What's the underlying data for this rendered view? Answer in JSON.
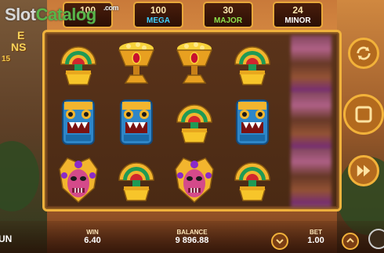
{
  "watermark": {
    "part1": "Slot",
    "part2": "Catalog",
    "part3": ".com"
  },
  "game_title": {
    "line1": "E",
    "line2": "NS",
    "line3": "15"
  },
  "jackpots": [
    {
      "name": "mini-jackpot",
      "value": "100",
      "label": ""
    },
    {
      "name": "mega-jackpot",
      "value": "100",
      "label": "MEGA",
      "color": "#3fd0ff"
    },
    {
      "name": "major-jackpot",
      "value": "30",
      "label": "MAJOR",
      "color": "#8ee04a"
    },
    {
      "name": "minor-jackpot",
      "value": "24",
      "label": "MINOR",
      "color": "#ffffff"
    }
  ],
  "grid": {
    "columns": 4,
    "rows": [
      [
        "green-fan",
        "treasure-chalice",
        "treasure-chalice",
        "green-fan"
      ],
      [
        "blue-mask",
        "blue-mask",
        "green-fan",
        "blue-mask"
      ],
      [
        "pink-mask",
        "green-fan",
        "pink-mask",
        "green-fan"
      ]
    ],
    "spinning_reel": "blurred-reel-5"
  },
  "controls": {
    "autoplay_icon": "refresh-icon",
    "spin_icon": "stop-square-icon",
    "turbo_icon": "fast-forward-icon"
  },
  "bottom": {
    "left_text": "UN",
    "win_label": "WIN",
    "win_value": "6.40",
    "balance_label": "BALANCE",
    "balance_value": "9 896.88",
    "bet_label": "BET",
    "bet_value": "1.00",
    "bet_down_icon": "chevron-down-icon",
    "bet_up_icon": "chevron-up-icon"
  },
  "colors": {
    "frame_gold": "#f0b23c",
    "reel_bg": "#5a331a",
    "watermark_green": "#59b548"
  }
}
